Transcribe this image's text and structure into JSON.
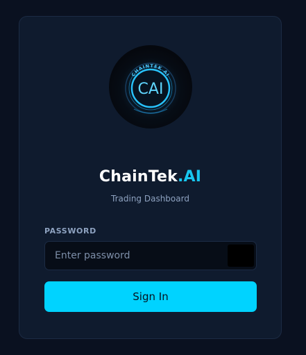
{
  "logo": {
    "ring_text": "CHAINTEK AI",
    "mark_text": "CAI",
    "glow_color": "#1fb6ff"
  },
  "brand": {
    "name": "ChainTek",
    "suffix": ".AI",
    "accent_color": "#18c7f0"
  },
  "subtitle": "Trading Dashboard",
  "password": {
    "label": "PASSWORD",
    "placeholder": "Enter password",
    "value": ""
  },
  "signin": {
    "label": "Sign In",
    "color": "#00d3ff"
  },
  "icons": {
    "toggle": "eye-icon"
  }
}
